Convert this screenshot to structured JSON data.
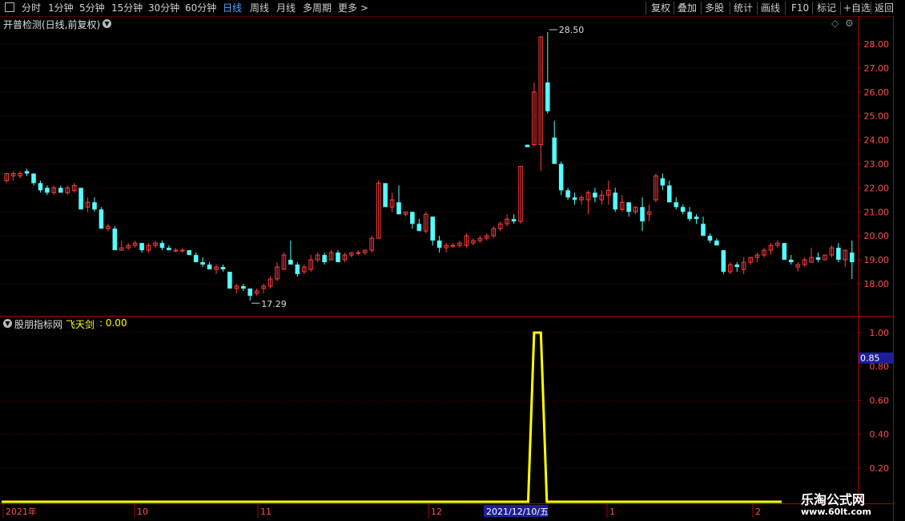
{
  "toolbar": {
    "left_items": [
      "分时",
      "1分钟",
      "5分钟",
      "15分钟",
      "30分钟",
      "60分钟",
      "日线",
      "周线",
      "月线",
      "多周期",
      "更多 >"
    ],
    "active": "日线",
    "right_items": [
      "复权",
      "叠加",
      "多股",
      "统计",
      "画线",
      "F10",
      "标记",
      "+自选",
      "返回"
    ]
  },
  "main_panel": {
    "title": "开普检测(日线,前复权)",
    "high_label": "28.50",
    "low_label": "17.29"
  },
  "indicator_panel": {
    "title": "股朋指标网",
    "name": "飞天剑",
    "value": ": 0.00",
    "marker_value": "0.85"
  },
  "watermark": {
    "line1": "乐淘公式网",
    "line2": "www.60lt.com"
  },
  "colors": {
    "up": "#ff3c3c",
    "down": "#54ffff",
    "grid": "#5a0000",
    "axis": "#aa0000",
    "indicator": "#ffff00",
    "cursor_bg": "#1e1e9a"
  },
  "chart_data": [
    {
      "type": "candlestick",
      "title": "开普检测(日线,前复权)",
      "ylim": [
        17.0,
        28.9
      ],
      "y_ticks": [
        "18.00",
        "19.00",
        "20.00",
        "21.00",
        "22.00",
        "23.00",
        "24.00",
        "25.00",
        "26.00",
        "27.00",
        "28.00"
      ],
      "x_ticks": [
        "2021年",
        "10",
        "11",
        "12",
        "2021/12/10/五",
        "1",
        "2"
      ],
      "annotations": [
        {
          "text": "28.50",
          "value": 28.5
        },
        {
          "text": "17.29",
          "value": 17.29
        }
      ],
      "candles": [
        [
          22.3,
          22.6,
          22.2,
          22.6
        ],
        [
          22.5,
          22.7,
          22.3,
          22.6
        ],
        [
          22.5,
          22.7,
          22.4,
          22.6
        ],
        [
          22.7,
          22.8,
          22.5,
          22.6
        ],
        [
          22.6,
          22.6,
          22.1,
          22.2
        ],
        [
          22.2,
          22.3,
          21.8,
          21.9
        ],
        [
          22.0,
          22.1,
          21.7,
          21.8
        ],
        [
          21.8,
          22.1,
          21.7,
          22.0
        ],
        [
          22.0,
          22.1,
          21.8,
          21.8
        ],
        [
          21.8,
          22.1,
          21.7,
          22.0
        ],
        [
          21.9,
          22.2,
          21.8,
          22.1
        ],
        [
          22.0,
          22.0,
          21.2,
          21.1
        ],
        [
          21.2,
          21.6,
          21.0,
          21.4
        ],
        [
          21.4,
          21.6,
          21.0,
          21.1
        ],
        [
          21.1,
          21.2,
          20.3,
          20.3
        ],
        [
          20.3,
          20.5,
          20.2,
          20.4
        ],
        [
          20.3,
          20.4,
          19.4,
          19.4
        ],
        [
          19.4,
          19.8,
          19.4,
          19.5
        ],
        [
          19.5,
          19.7,
          19.4,
          19.6
        ],
        [
          19.6,
          19.8,
          19.5,
          19.7
        ],
        [
          19.7,
          19.7,
          19.3,
          19.4
        ],
        [
          19.4,
          19.7,
          19.3,
          19.6
        ],
        [
          19.6,
          19.8,
          19.5,
          19.7
        ],
        [
          19.7,
          19.8,
          19.4,
          19.5
        ],
        [
          19.5,
          19.6,
          19.4,
          19.4
        ],
        [
          19.4,
          19.5,
          19.3,
          19.4
        ],
        [
          19.4,
          19.5,
          19.3,
          19.4
        ],
        [
          19.4,
          19.4,
          19.2,
          19.2
        ],
        [
          19.2,
          19.3,
          18.9,
          18.9
        ],
        [
          18.9,
          19.1,
          18.7,
          18.8
        ],
        [
          18.8,
          18.9,
          18.6,
          18.6
        ],
        [
          18.6,
          18.8,
          18.4,
          18.7
        ],
        [
          18.7,
          18.8,
          18.5,
          18.6
        ],
        [
          18.5,
          18.5,
          17.8,
          17.8
        ],
        [
          17.8,
          18.0,
          17.6,
          17.9
        ],
        [
          17.9,
          18.0,
          17.7,
          17.8
        ],
        [
          17.8,
          17.8,
          17.3,
          17.5
        ],
        [
          17.6,
          17.8,
          17.5,
          17.7
        ],
        [
          17.8,
          18.0,
          17.6,
          17.9
        ],
        [
          17.9,
          18.3,
          17.8,
          18.2
        ],
        [
          18.2,
          18.9,
          18.1,
          18.7
        ],
        [
          18.6,
          19.3,
          18.6,
          19.2
        ],
        [
          19.0,
          19.8,
          18.9,
          18.8
        ],
        [
          18.8,
          18.9,
          18.3,
          18.4
        ],
        [
          18.5,
          18.8,
          18.4,
          18.7
        ],
        [
          18.6,
          19.2,
          18.5,
          19.0
        ],
        [
          19.0,
          19.3,
          18.9,
          19.2
        ],
        [
          19.2,
          19.3,
          18.8,
          18.9
        ],
        [
          19.0,
          19.4,
          19.0,
          19.3
        ],
        [
          19.3,
          19.4,
          18.9,
          18.9
        ],
        [
          19.0,
          19.3,
          18.9,
          19.2
        ],
        [
          19.2,
          19.3,
          19.1,
          19.3
        ],
        [
          19.3,
          19.4,
          19.2,
          19.3
        ],
        [
          19.3,
          19.4,
          19.2,
          19.4
        ],
        [
          19.4,
          20.0,
          19.3,
          19.9
        ],
        [
          19.9,
          22.3,
          19.9,
          22.2
        ],
        [
          22.2,
          22.2,
          21.2,
          21.2
        ],
        [
          21.2,
          21.8,
          21.0,
          21.5
        ],
        [
          21.4,
          22.1,
          20.9,
          20.9
        ],
        [
          20.9,
          21.0,
          20.8,
          21.0
        ],
        [
          21.0,
          21.0,
          20.3,
          20.5
        ],
        [
          20.5,
          20.7,
          20.2,
          20.2
        ],
        [
          20.2,
          21.0,
          20.1,
          20.9
        ],
        [
          20.8,
          20.8,
          19.6,
          19.8
        ],
        [
          19.8,
          20.0,
          19.3,
          19.5
        ],
        [
          19.5,
          19.7,
          19.3,
          19.6
        ],
        [
          19.6,
          19.7,
          19.5,
          19.6
        ],
        [
          19.6,
          19.8,
          19.5,
          19.7
        ],
        [
          19.6,
          20.1,
          19.5,
          20.0
        ],
        [
          19.7,
          19.9,
          19.6,
          19.8
        ],
        [
          19.8,
          20.0,
          19.7,
          19.9
        ],
        [
          19.9,
          20.1,
          19.8,
          20.0
        ],
        [
          20.0,
          20.4,
          19.9,
          20.3
        ],
        [
          20.3,
          20.6,
          20.2,
          20.5
        ],
        [
          20.5,
          20.9,
          20.4,
          20.7
        ],
        [
          20.7,
          20.9,
          20.5,
          20.6
        ],
        [
          20.6,
          22.9,
          20.5,
          22.9
        ],
        [
          23.8,
          23.8,
          23.7,
          23.7
        ],
        [
          23.8,
          26.4,
          23.7,
          26.0
        ],
        [
          23.8,
          28.3,
          22.7,
          28.3
        ],
        [
          26.4,
          28.5,
          25.1,
          25.2
        ],
        [
          24.1,
          24.8,
          23.1,
          23.0
        ],
        [
          23.0,
          23.1,
          21.7,
          21.9
        ],
        [
          21.9,
          22.0,
          21.5,
          21.6
        ],
        [
          21.6,
          21.8,
          21.3,
          21.5
        ],
        [
          21.5,
          21.7,
          21.3,
          21.6
        ],
        [
          21.5,
          21.9,
          20.9,
          21.8
        ],
        [
          21.8,
          22.0,
          21.4,
          21.6
        ],
        [
          21.5,
          21.9,
          21.3,
          21.7
        ],
        [
          21.7,
          22.3,
          21.3,
          21.9
        ],
        [
          21.8,
          22.0,
          21.0,
          21.1
        ],
        [
          21.1,
          21.7,
          21.0,
          21.4
        ],
        [
          21.4,
          21.4,
          20.8,
          21.0
        ],
        [
          21.0,
          21.2,
          20.9,
          21.2
        ],
        [
          21.2,
          21.6,
          20.2,
          20.6
        ],
        [
          20.9,
          21.3,
          20.6,
          21.0
        ],
        [
          21.5,
          22.6,
          21.4,
          22.5
        ],
        [
          22.4,
          22.6,
          21.9,
          22.1
        ],
        [
          22.1,
          22.3,
          21.4,
          21.4
        ],
        [
          21.4,
          21.6,
          21.1,
          21.2
        ],
        [
          21.2,
          21.3,
          20.9,
          21.0
        ],
        [
          21.0,
          21.2,
          20.6,
          20.7
        ],
        [
          20.8,
          20.9,
          20.5,
          20.7
        ],
        [
          20.5,
          20.8,
          20.0,
          20.0
        ],
        [
          20.0,
          20.1,
          19.7,
          19.8
        ],
        [
          19.8,
          19.9,
          19.6,
          19.6
        ],
        [
          19.4,
          19.4,
          18.4,
          18.5
        ],
        [
          18.5,
          18.9,
          18.4,
          18.8
        ],
        [
          18.8,
          18.9,
          18.5,
          18.7
        ],
        [
          18.6,
          19.1,
          18.4,
          18.9
        ],
        [
          18.9,
          19.1,
          18.8,
          19.1
        ],
        [
          19.1,
          19.3,
          18.9,
          19.2
        ],
        [
          19.2,
          19.5,
          19.1,
          19.4
        ],
        [
          19.4,
          19.7,
          19.2,
          19.6
        ],
        [
          19.6,
          19.8,
          19.5,
          19.7
        ],
        [
          19.7,
          19.7,
          19.0,
          19.0
        ],
        [
          19.0,
          19.2,
          18.8,
          18.9
        ],
        [
          18.7,
          18.9,
          18.5,
          18.8
        ],
        [
          18.8,
          19.1,
          18.7,
          19.0
        ],
        [
          18.9,
          19.5,
          18.9,
          19.1
        ],
        [
          19.1,
          19.3,
          18.9,
          19.0
        ],
        [
          19.0,
          19.2,
          19.0,
          19.2
        ],
        [
          19.2,
          19.6,
          19.1,
          19.5
        ],
        [
          19.5,
          19.7,
          18.9,
          19.0
        ],
        [
          19.0,
          19.4,
          18.7,
          19.4
        ],
        [
          19.3,
          19.8,
          18.2,
          18.9
        ]
      ]
    },
    {
      "type": "line",
      "title": "飞天剑",
      "ylim": [
        0.0,
        1.05
      ],
      "y_ticks": [
        "0.20",
        "0.40",
        "0.60",
        "0.80",
        "1.00"
      ],
      "x_ticks": [
        "2021年",
        "10",
        "11",
        "12",
        "2021/12/10/五",
        "1",
        "2"
      ],
      "series": [
        {
          "name": "飞天剑",
          "pulse": [
            {
              "index": 78,
              "value": 1.0
            },
            {
              "index": 79,
              "value": 1.0
            }
          ],
          "baseline": 0.0
        }
      ]
    }
  ]
}
